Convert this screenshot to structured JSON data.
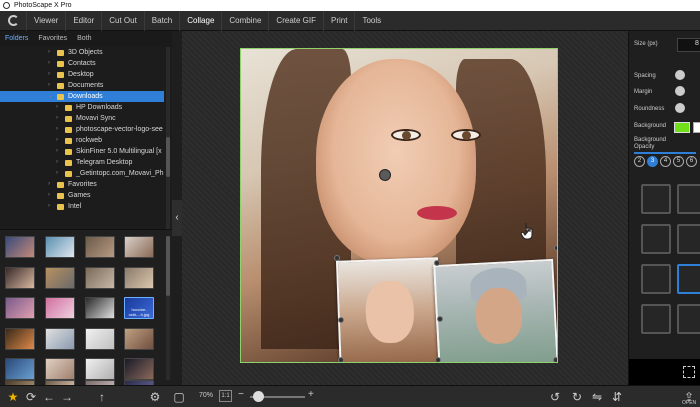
{
  "window": {
    "title": "PhotoScape X Pro"
  },
  "menu": {
    "items": [
      {
        "label": "Viewer",
        "active": false
      },
      {
        "label": "Editor",
        "active": false
      },
      {
        "label": "Cut Out",
        "active": false
      },
      {
        "label": "Batch",
        "active": false
      },
      {
        "label": "Collage",
        "active": true
      },
      {
        "label": "Combine",
        "active": false
      },
      {
        "label": "Create GIF",
        "active": false
      },
      {
        "label": "Print",
        "active": false
      },
      {
        "label": "Tools",
        "active": false
      }
    ]
  },
  "leftpanel": {
    "tabs": [
      {
        "label": "Folders",
        "active": true
      },
      {
        "label": "Favorites",
        "active": false
      },
      {
        "label": "Both",
        "active": false
      }
    ],
    "tree": [
      {
        "label": "3D Objects",
        "indent": 1,
        "selected": false
      },
      {
        "label": "Contacts",
        "indent": 1,
        "selected": false
      },
      {
        "label": "Desktop",
        "indent": 1,
        "selected": false
      },
      {
        "label": "Documents",
        "indent": 1,
        "selected": false
      },
      {
        "label": "Downloads",
        "indent": 1,
        "selected": true
      },
      {
        "label": "HP Downloads",
        "indent": 2,
        "selected": false
      },
      {
        "label": "Movavi Sync",
        "indent": 2,
        "selected": false
      },
      {
        "label": "photoscape-vector-logo-see",
        "indent": 2,
        "selected": false
      },
      {
        "label": "rockweb",
        "indent": 2,
        "selected": false
      },
      {
        "label": "SkinFiner 5.0 Multilingual [x",
        "indent": 2,
        "selected": false
      },
      {
        "label": "Telegram Desktop",
        "indent": 2,
        "selected": false
      },
      {
        "label": "_Getintopc.com_Movavi_Ph",
        "indent": 2,
        "selected": false
      },
      {
        "label": "Favorites",
        "indent": 1,
        "selected": false
      },
      {
        "label": "Games",
        "indent": 1,
        "selected": false
      },
      {
        "label": "Intel",
        "indent": 1,
        "selected": false
      }
    ],
    "thumb_caption": "hovcine-ncbi-...h.jpg"
  },
  "zoom": {
    "value": "70%",
    "one_to_one": "1:1",
    "level": 0.07
  },
  "rightpanel": {
    "size_label": "Size (px)",
    "size_value": "8",
    "spacing_label": "Spacing",
    "margin_label": "Margin",
    "roundness_label": "Roundness",
    "background_label": "Background",
    "bg_opacity_label": "Background Opacity",
    "counts": [
      "2",
      "3",
      "4",
      "5",
      "6"
    ],
    "active_count": "3",
    "background_color": "#6fe01a",
    "open_label": "OPEN"
  },
  "colors": {
    "accent": "#2f7fd8",
    "selection_border": "#8fd16a"
  }
}
